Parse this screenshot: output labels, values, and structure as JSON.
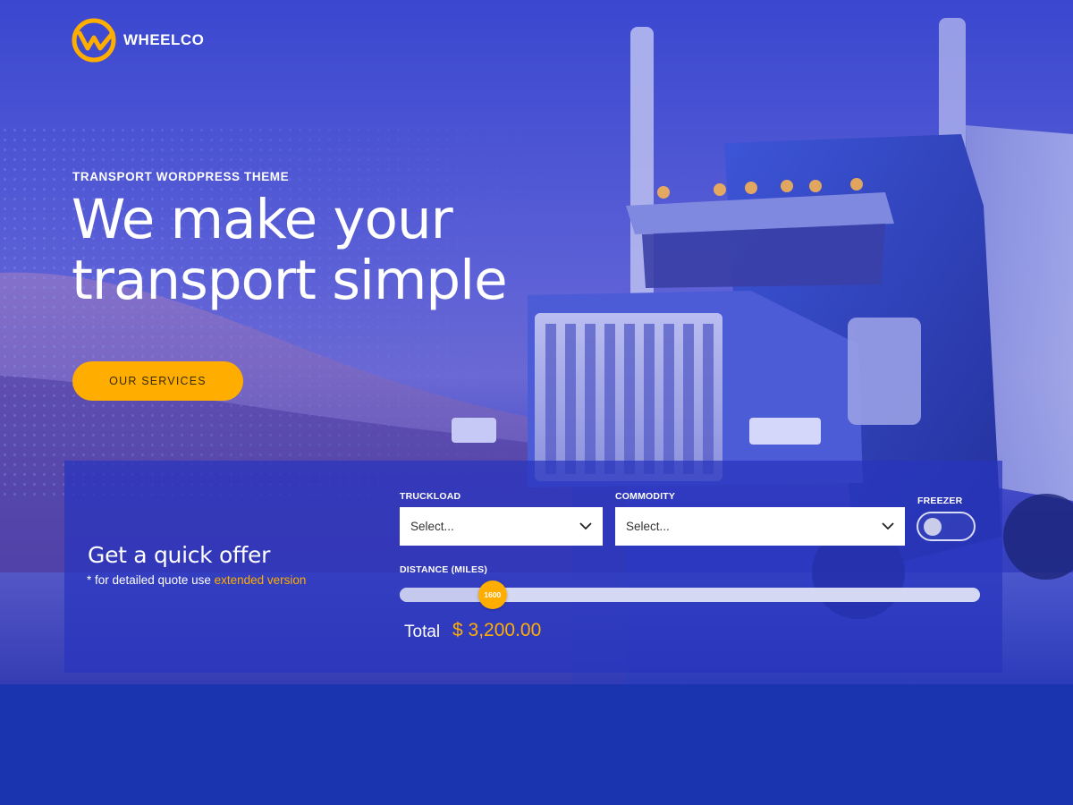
{
  "brand": {
    "name": "WHEELCO",
    "logo_icon": "wheelco-w-logo-icon",
    "accent_color": "#ffae00"
  },
  "hero": {
    "eyebrow": "TRANSPORT WORDPRESS THEME",
    "headline_line1": "We make your",
    "headline_line2": "transport simple",
    "cta_label": "OUR SERVICES",
    "background_image": "blue-tinted-semi-truck-photo"
  },
  "quote": {
    "title": "Get a quick offer",
    "note_prefix": "* for detailed quote use ",
    "note_link": "extended version",
    "truckload": {
      "label": "TRUCKLOAD",
      "value": "Select..."
    },
    "commodity": {
      "label": "COMMODITY",
      "value": "Select..."
    },
    "freezer": {
      "label": "FREEZER",
      "on": false
    },
    "distance": {
      "label": "DISTANCE (MILES)",
      "value": 1600,
      "value_text": "1600",
      "fraction": 0.16
    },
    "total_label": "Total",
    "total_value": "$  3,200.00"
  },
  "colors": {
    "panel": "#2834be",
    "page_bottom": "#1a34b0",
    "select_bg": "#ffffff"
  }
}
